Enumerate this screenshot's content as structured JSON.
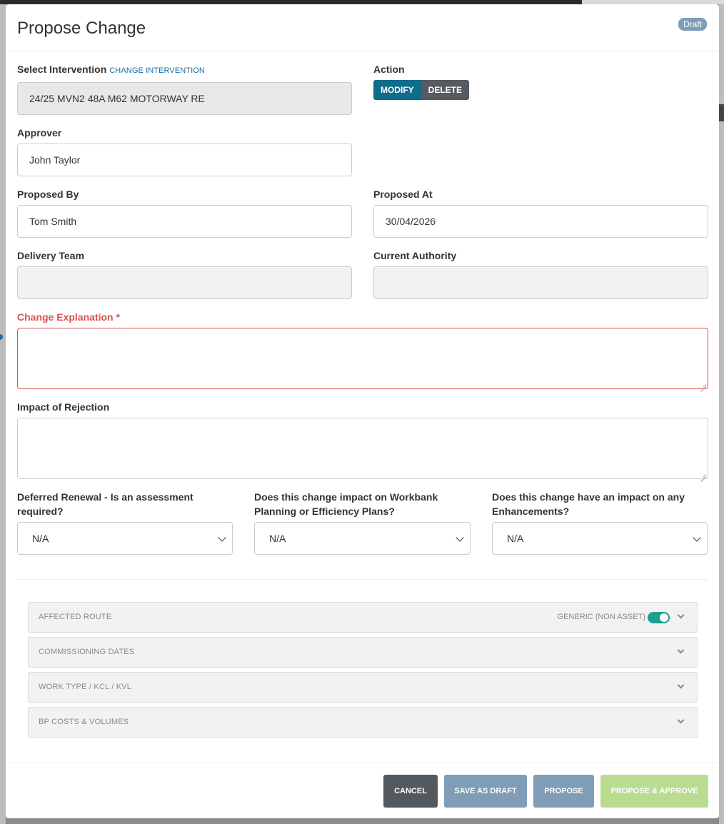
{
  "modal": {
    "title": "Propose Change",
    "status_badge": "Draft"
  },
  "intervention": {
    "label": "Select Intervention",
    "change_link": "CHANGE INTERVENTION",
    "value": "24/25 MVN2 48A M62 MOTORWAY RE"
  },
  "action": {
    "label": "Action",
    "options": [
      "MODIFY",
      "DELETE"
    ],
    "selected": "MODIFY"
  },
  "approver": {
    "label": "Approver",
    "value": "John Taylor"
  },
  "proposed_by": {
    "label": "Proposed By",
    "value": "Tom Smith"
  },
  "proposed_at": {
    "label": "Proposed At",
    "value": "30/04/2026"
  },
  "delivery_team": {
    "label": "Delivery Team",
    "value": ""
  },
  "current_authority": {
    "label": "Current Authority",
    "value": ""
  },
  "change_explanation": {
    "label": "Change Explanation *",
    "value": ""
  },
  "impact_of_rejection": {
    "label": "Impact of Rejection",
    "value": ""
  },
  "questions": [
    {
      "label": "Deferred Renewal - Is an assessment required?",
      "value": "N/A"
    },
    {
      "label": "Does this change impact on Workbank Planning or Efficiency Plans?",
      "value": "N/A"
    },
    {
      "label": "Does this change have an impact on any Enhancements?",
      "value": "N/A"
    }
  ],
  "sections": [
    {
      "title": "AFFECTED ROUTE",
      "toggle_label": "GENERIC (NON ASSET)",
      "toggle_on": true
    },
    {
      "title": "COMMISSIONING DATES"
    },
    {
      "title": "WORK TYPE / KCL / KVL"
    },
    {
      "title": "BP COSTS & VOLUMES"
    }
  ],
  "footer": {
    "cancel": "CANCEL",
    "save_draft": "SAVE AS DRAFT",
    "propose": "PROPOSE",
    "propose_approve": "PROPOSE & APPROVE"
  },
  "colors": {
    "primary": "#0e6d8b",
    "badge": "#7f9db6",
    "error": "#d9534f",
    "toggle": "#1aa08f",
    "approve_disabled": "#b9dc91"
  }
}
